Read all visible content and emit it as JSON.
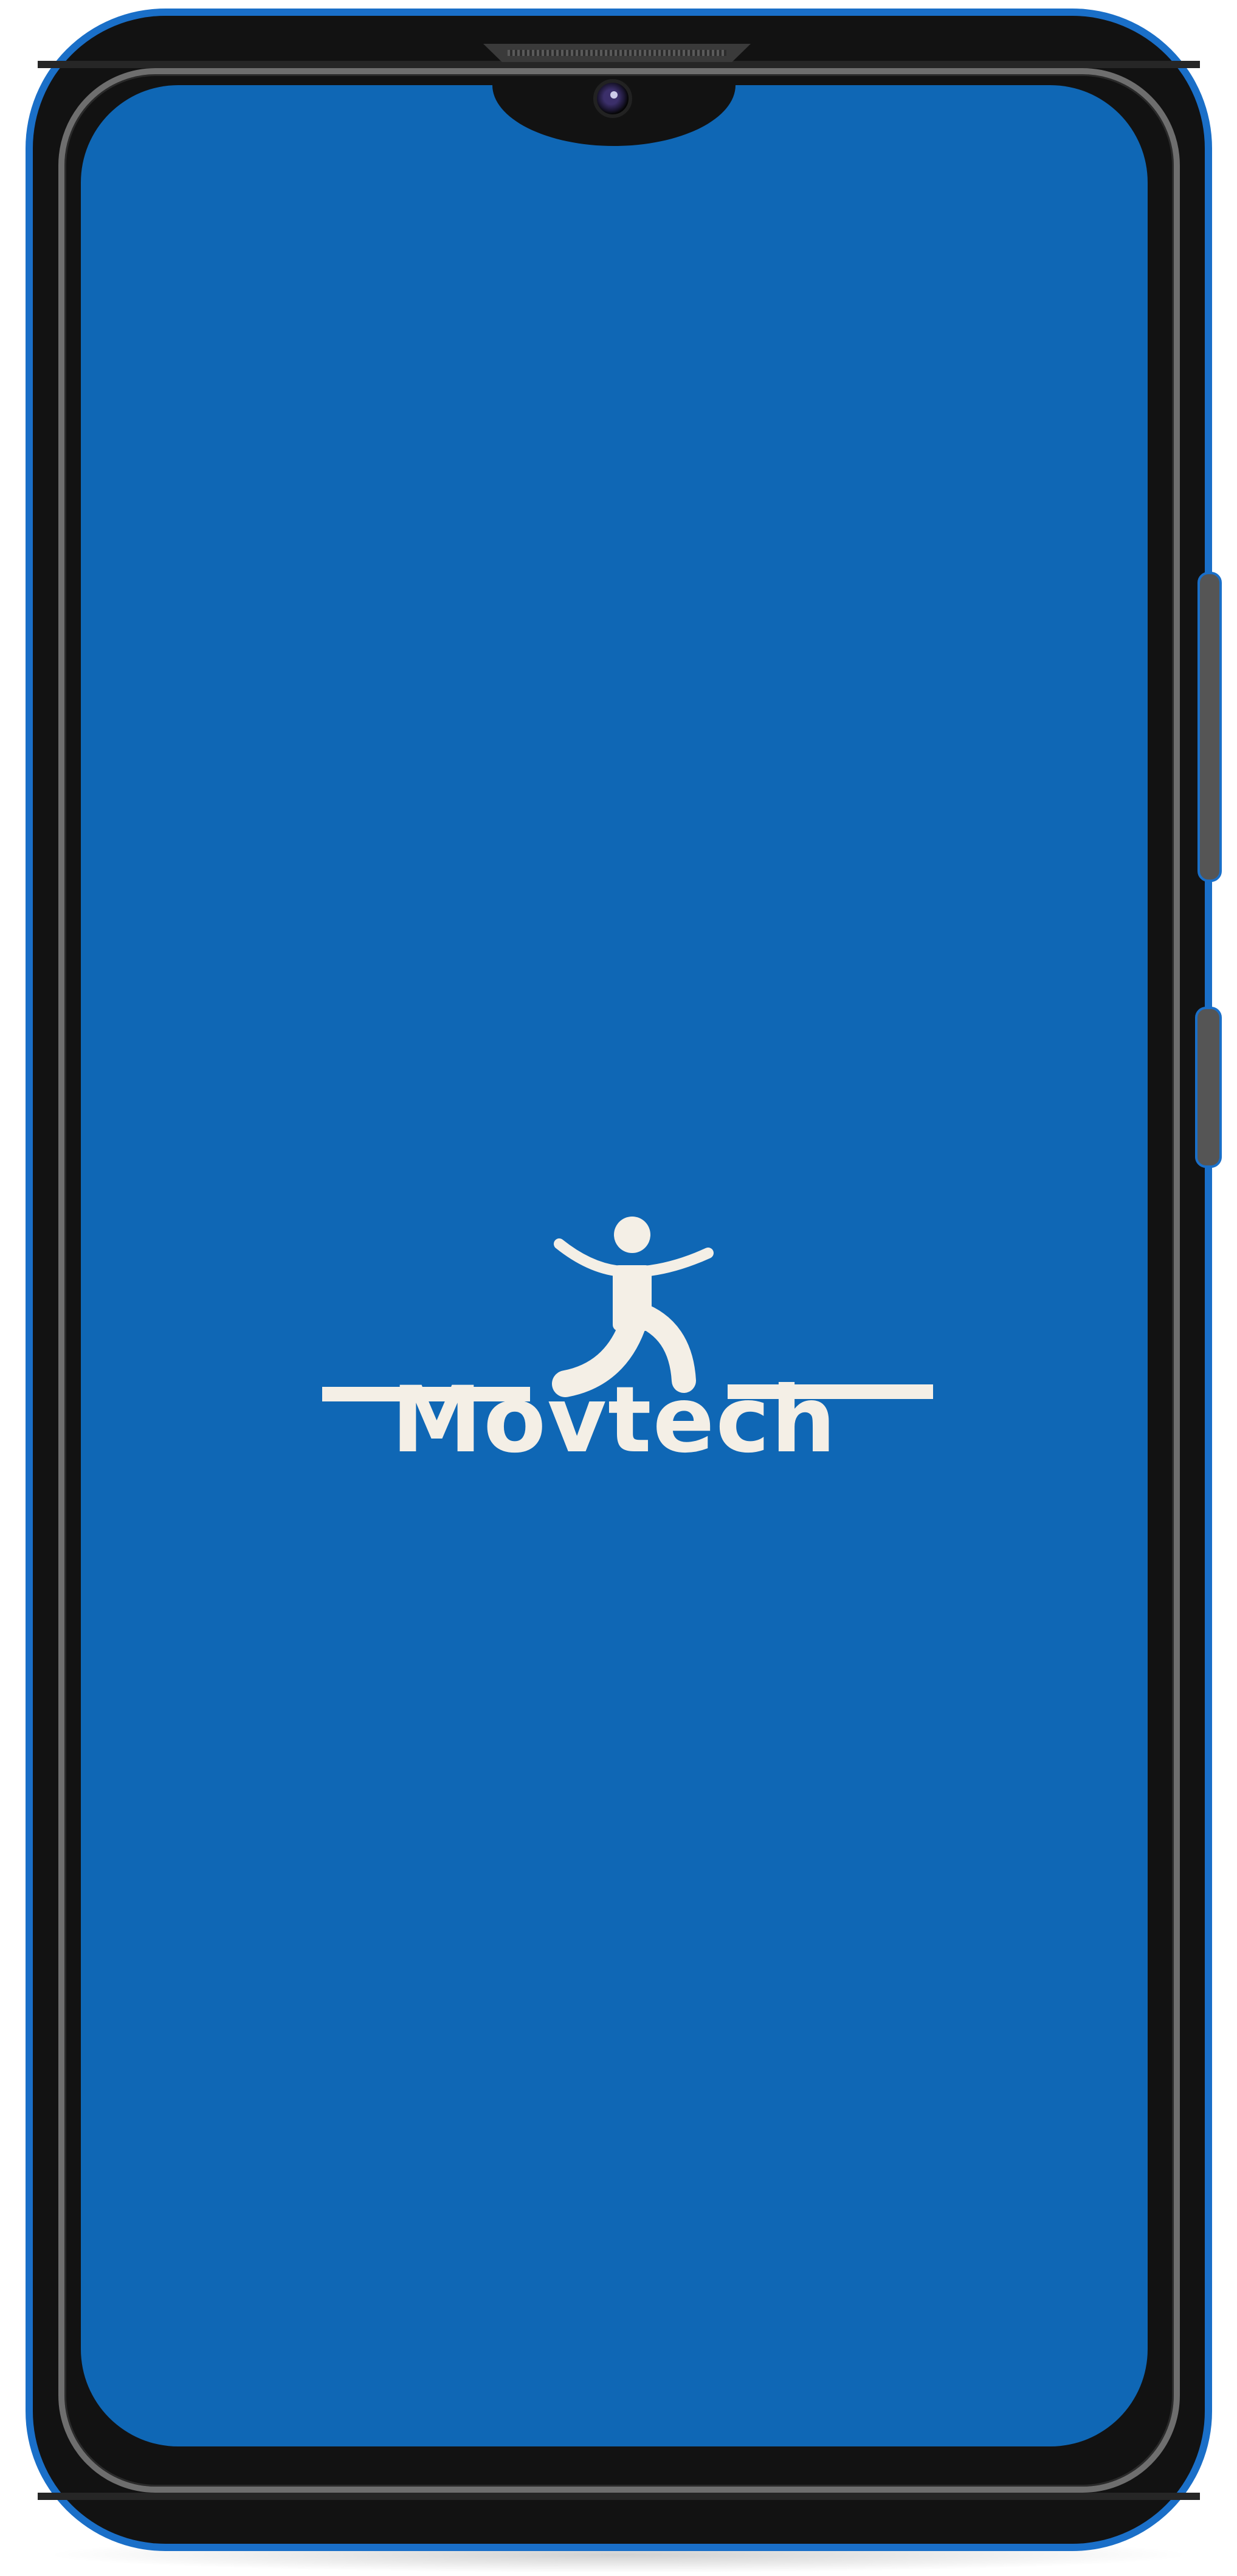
{
  "app": {
    "brand_name": "Movtech",
    "logo_icon": "person-balancing-icon"
  },
  "colors": {
    "screen_background": "#0f67b5",
    "logo_color": "#f4efe6",
    "device_frame_accent": "#1a6fc8",
    "device_body": "#121212"
  }
}
